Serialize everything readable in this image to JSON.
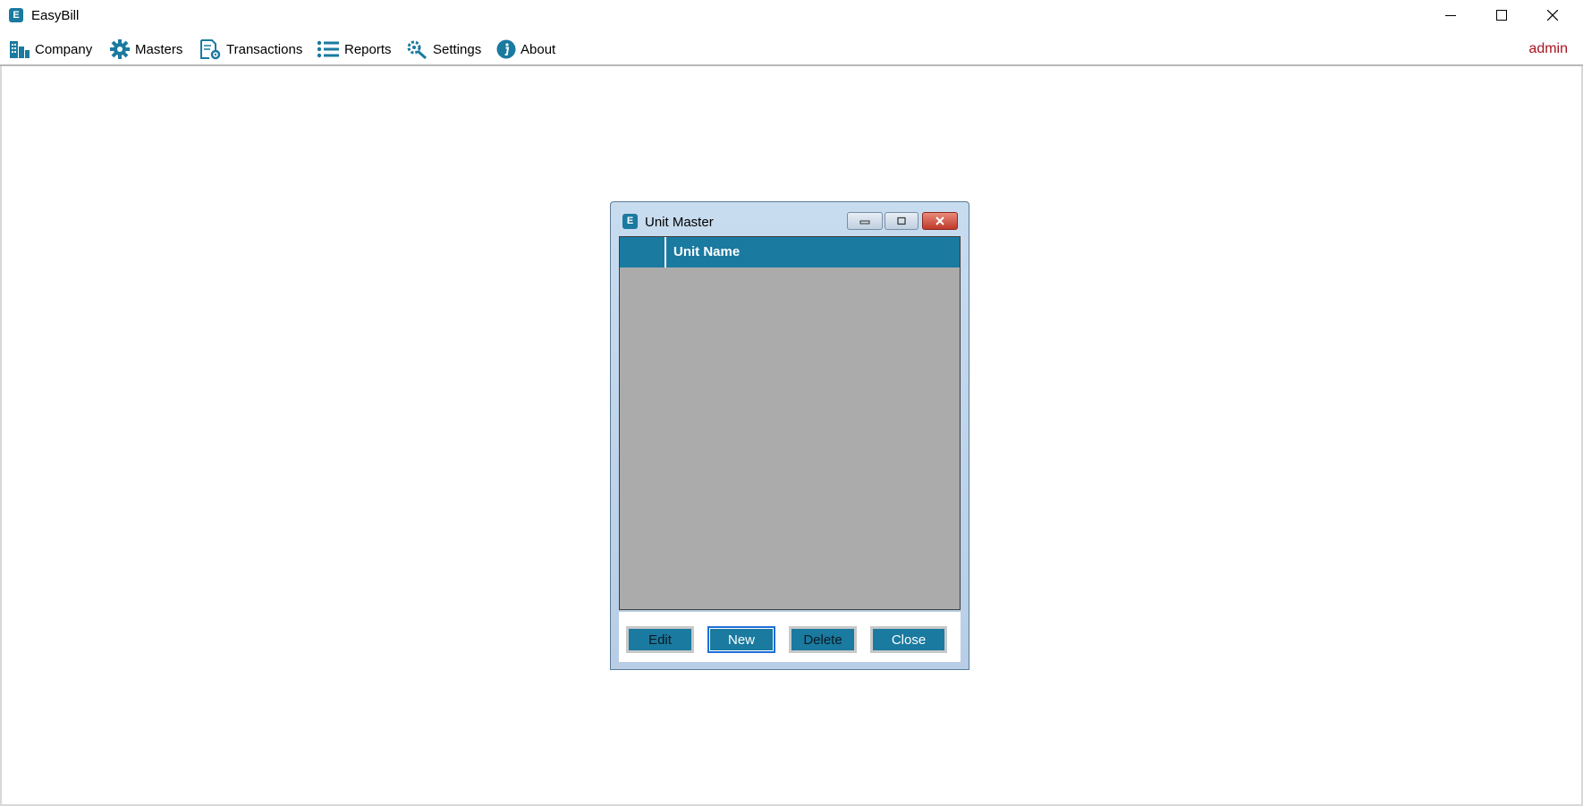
{
  "app": {
    "title": "EasyBill",
    "icon_letter": "E"
  },
  "menu": {
    "items": [
      {
        "label": "Company",
        "icon": "building-icon"
      },
      {
        "label": "Masters",
        "icon": "gear-icon"
      },
      {
        "label": "Transactions",
        "icon": "document-gear-icon"
      },
      {
        "label": "Reports",
        "icon": "list-icon"
      },
      {
        "label": "Settings",
        "icon": "wrench-gear-icon"
      },
      {
        "label": "About",
        "icon": "info-icon"
      }
    ],
    "user": "admin"
  },
  "dialog": {
    "title": "Unit Master",
    "icon_letter": "E",
    "grid": {
      "columns": [
        "Unit Name"
      ],
      "rows": []
    },
    "buttons": {
      "edit": "Edit",
      "new": "New",
      "delete": "Delete",
      "close": "Close"
    }
  },
  "colors": {
    "accent": "#1a7aa0",
    "user": "#a8131f",
    "grid_bg": "#ababab"
  }
}
